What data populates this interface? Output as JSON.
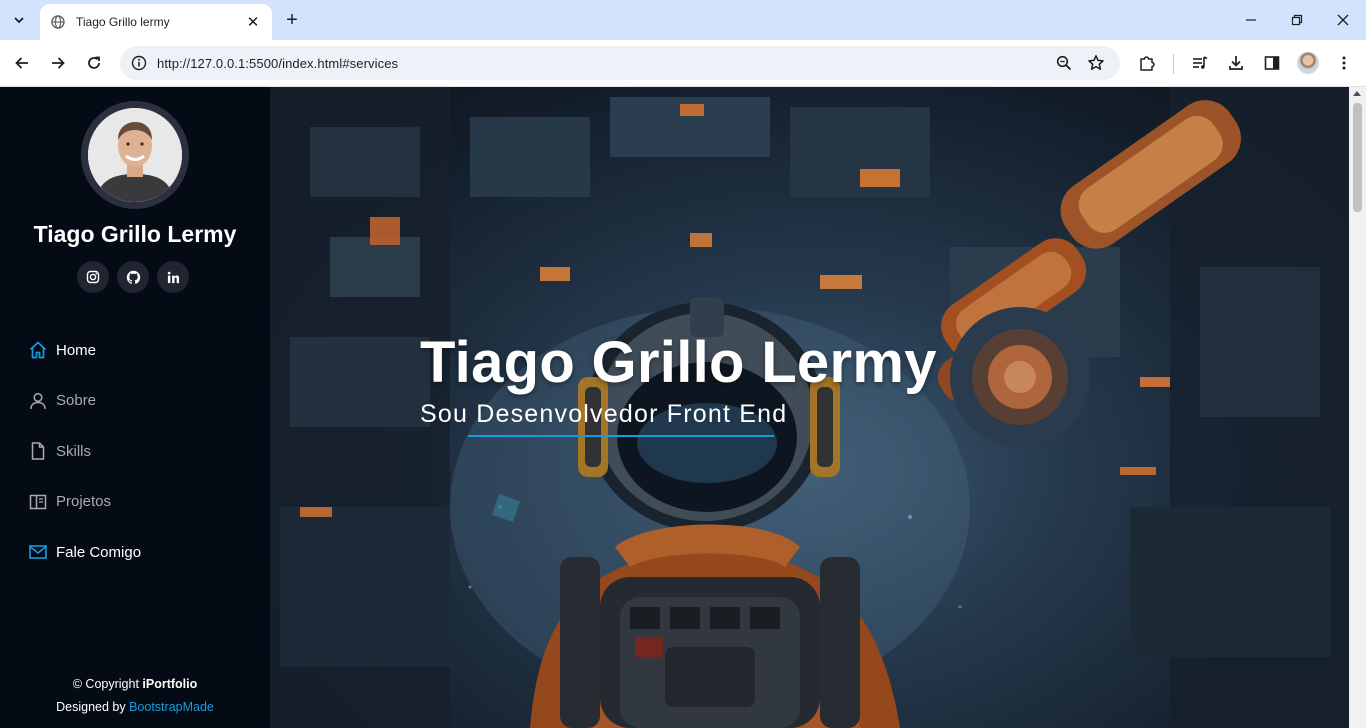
{
  "browser": {
    "tab_title": "Tiago Grillo lermy",
    "tab_close": "✕",
    "new_tab": "+",
    "url": "http://127.0.0.1:5500/index.html#services"
  },
  "sidebar": {
    "name": "Tiago Grillo Lermy",
    "social": [
      "instagram-icon",
      "github-icon",
      "linkedin-icon"
    ],
    "nav": [
      {
        "label": "Home",
        "icon": "home-icon",
        "active": true
      },
      {
        "label": "Sobre",
        "icon": "person-icon",
        "active": false
      },
      {
        "label": "Skills",
        "icon": "file-icon",
        "active": false
      },
      {
        "label": "Projetos",
        "icon": "layout-icon",
        "active": false
      },
      {
        "label": "Fale Comigo",
        "icon": "envelope-icon",
        "active": false
      }
    ],
    "footer": {
      "copyright_prefix": "© Copyright ",
      "copyright_brand": "iPortfolio",
      "designed_by": "Designed by ",
      "designer": "BootstrapMade"
    }
  },
  "hero": {
    "title": "Tiago Grillo Lermy",
    "subtitle": "Sou Desenvolvedor Front End"
  },
  "colors": {
    "accent": "#149ddd",
    "sidebar_bg": "#040b14",
    "social_bg": "#212431"
  }
}
